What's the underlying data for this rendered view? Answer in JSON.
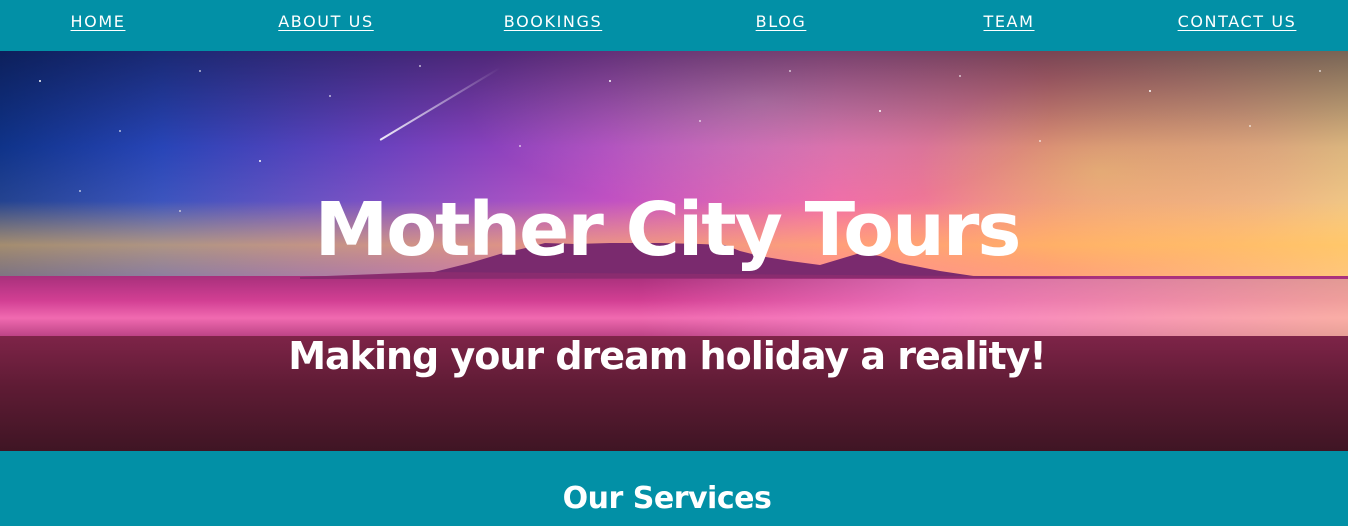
{
  "nav": {
    "items": [
      {
        "label": "HOME"
      },
      {
        "label": "ABOUT US"
      },
      {
        "label": "BOOKINGS"
      },
      {
        "label": "BLOG"
      },
      {
        "label": "TEAM"
      },
      {
        "label": "CONTACT US"
      }
    ]
  },
  "hero": {
    "title": "Mother City Tours",
    "subtitle": "Making your dream holiday a reality!"
  },
  "services": {
    "heading": "Our Services"
  },
  "colors": {
    "brand_teal": "#0290a6",
    "text": "#ffffff"
  }
}
